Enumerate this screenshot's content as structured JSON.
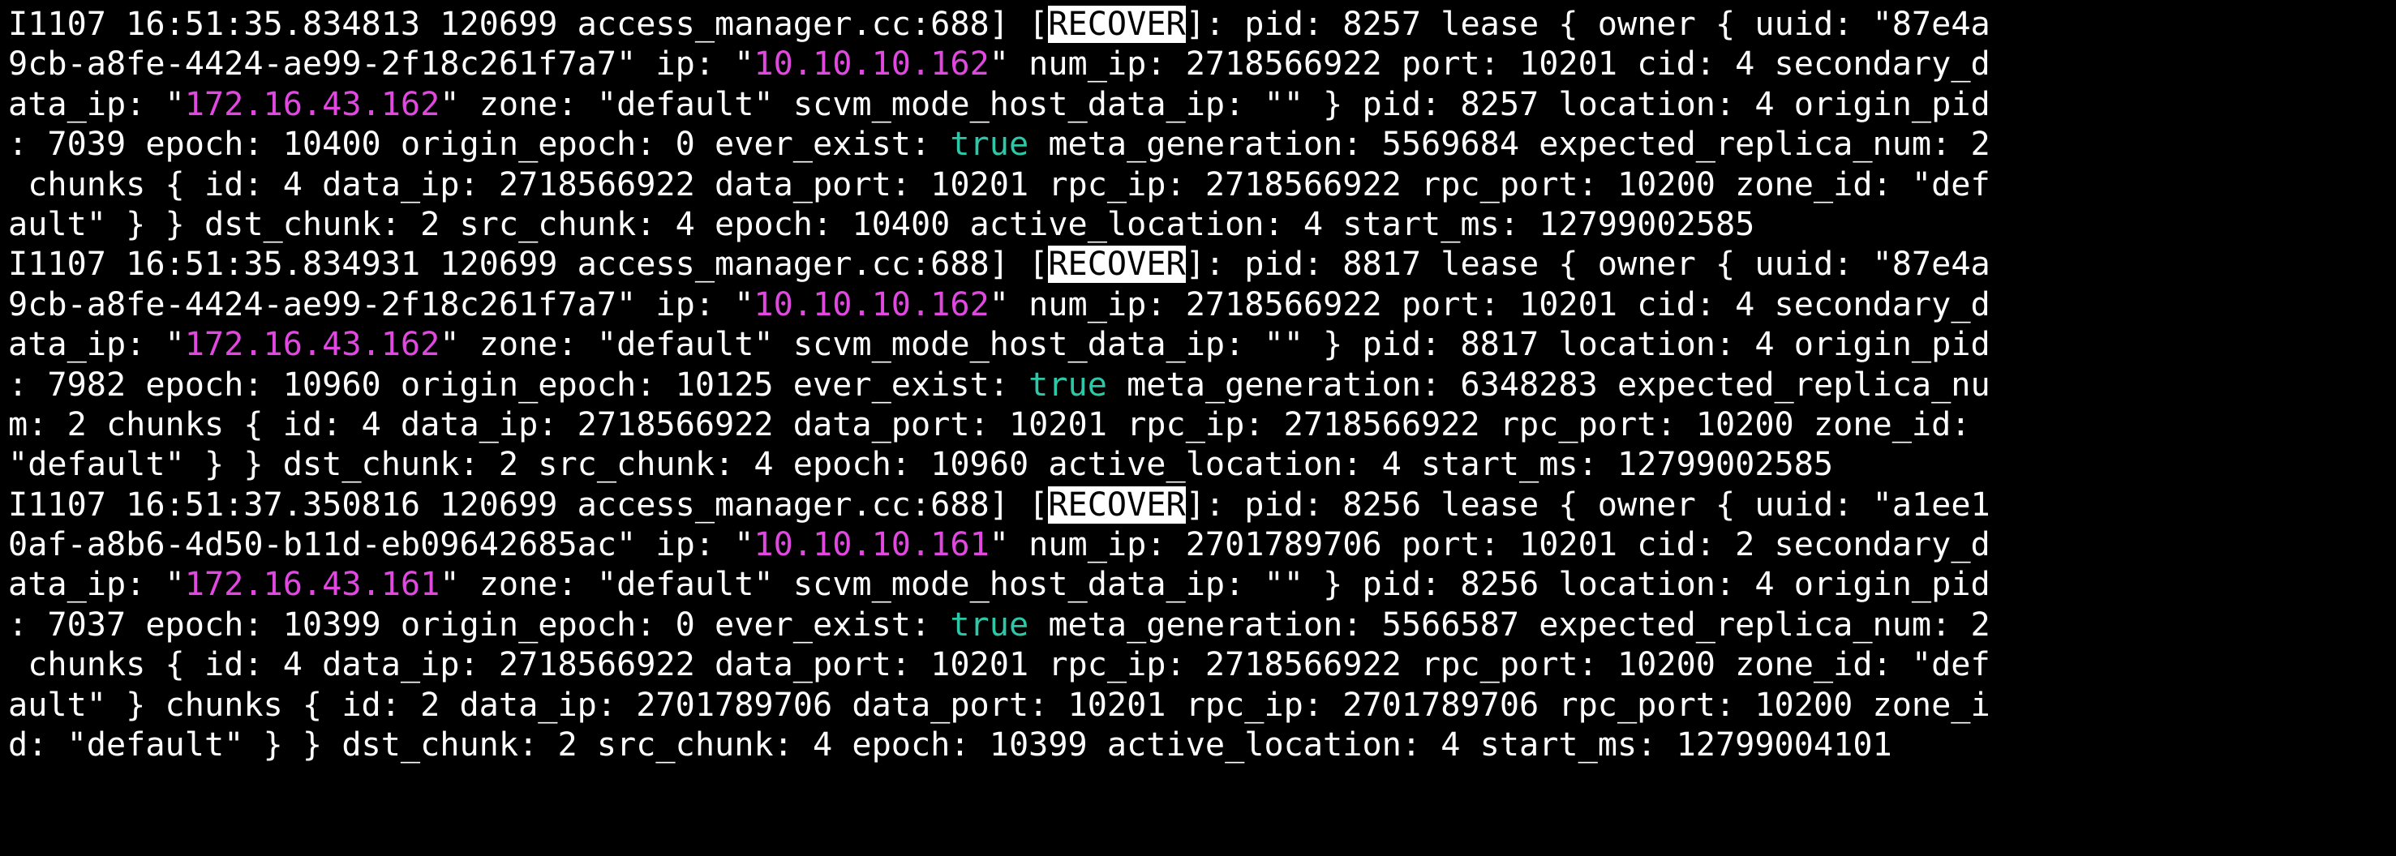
{
  "colors": {
    "background": "#000000",
    "text": "#ffffff",
    "ip_highlight": "#e048e0",
    "keyword_true": "#2cc8a8",
    "tag_background": "#ffffff",
    "tag_text": "#000000"
  },
  "log_lines": [
    [
      "I1107 16:51:35.834813 120699 access_manager.cc:688] [",
      "RECOVER",
      "]: pid: 8257 lease { owner { uuid: \"87e4a"
    ],
    [
      "9cb-a8fe-4424-ae99-2f18c261f7a7\" ip: \"",
      "10.10.10.162",
      "\" num_ip: 2718566922 port: 10201 cid: 4 secondary_d"
    ],
    [
      "ata_ip: \"",
      "172.16.43.162",
      "\" zone: \"default\" scvm_mode_host_data_ip: \"\" } pid: 8257 location: 4 origin_pid"
    ],
    [
      ": 7039 epoch: 10400 origin_epoch: 0 ever_exist: ",
      "true",
      " meta_generation: 5569684 expected_replica_num: 2"
    ],
    [
      " chunks { id: 4 data_ip: 2718566922 data_port: 10201 rpc_ip: 2718566922 rpc_port: 10200 zone_id: \"def"
    ],
    [
      "ault\" } } dst_chunk: 2 src_chunk: 4 epoch: 10400 active_location: 4 start_ms: 12799002585"
    ],
    [
      "I1107 16:51:35.834931 120699 access_manager.cc:688] [",
      "RECOVER",
      "]: pid: 8817 lease { owner { uuid: \"87e4a"
    ],
    [
      "9cb-a8fe-4424-ae99-2f18c261f7a7\" ip: \"",
      "10.10.10.162",
      "\" num_ip: 2718566922 port: 10201 cid: 4 secondary_d"
    ],
    [
      "ata_ip: \"",
      "172.16.43.162",
      "\" zone: \"default\" scvm_mode_host_data_ip: \"\" } pid: 8817 location: 4 origin_pid"
    ],
    [
      ": 7982 epoch: 10960 origin_epoch: 10125 ever_exist: ",
      "true",
      " meta_generation: 6348283 expected_replica_nu"
    ],
    [
      "m: 2 chunks { id: 4 data_ip: 2718566922 data_port: 10201 rpc_ip: 2718566922 rpc_port: 10200 zone_id:"
    ],
    [
      "\"default\" } } dst_chunk: 2 src_chunk: 4 epoch: 10960 active_location: 4 start_ms: 12799002585"
    ],
    [
      "I1107 16:51:37.350816 120699 access_manager.cc:688] [",
      "RECOVER",
      "]: pid: 8256 lease { owner { uuid: \"a1ee1"
    ],
    [
      "0af-a8b6-4d50-b11d-eb09642685ac\" ip: \"",
      "10.10.10.161",
      "\" num_ip: 2701789706 port: 10201 cid: 2 secondary_d"
    ],
    [
      "ata_ip: \"",
      "172.16.43.161",
      "\" zone: \"default\" scvm_mode_host_data_ip: \"\" } pid: 8256 location: 4 origin_pid"
    ],
    [
      ": 7037 epoch: 10399 origin_epoch: 0 ever_exist: ",
      "true",
      " meta_generation: 5566587 expected_replica_num: 2"
    ],
    [
      " chunks { id: 4 data_ip: 2718566922 data_port: 10201 rpc_ip: 2718566922 rpc_port: 10200 zone_id: \"def"
    ],
    [
      "ault\" } chunks { id: 2 data_ip: 2701789706 data_port: 10201 rpc_ip: 2701789706 rpc_port: 10200 zone_i"
    ],
    [
      "d: \"default\" } } dst_chunk: 2 src_chunk: 4 epoch: 10399 active_location: 4 start_ms: 12799004101"
    ]
  ]
}
